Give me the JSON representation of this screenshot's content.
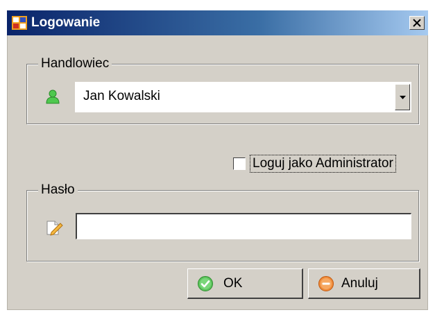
{
  "window": {
    "title": "Logowanie",
    "close_label": "×"
  },
  "salesperson": {
    "group_label": "Handlowiec",
    "selected": "Jan Kowalski",
    "icon": "user-icon"
  },
  "admin_checkbox": {
    "label": "Loguj jako Administrator",
    "checked": false
  },
  "password": {
    "group_label": "Hasło",
    "value": "",
    "icon": "pencil-note-icon"
  },
  "buttons": {
    "ok_label": "OK",
    "cancel_label": "Anuluj"
  },
  "colors": {
    "title_gradient_start": "#0a246a",
    "dialog_bg": "#d4d0c8",
    "ok_icon": "#4fb84f",
    "cancel_icon": "#f08c3a"
  }
}
